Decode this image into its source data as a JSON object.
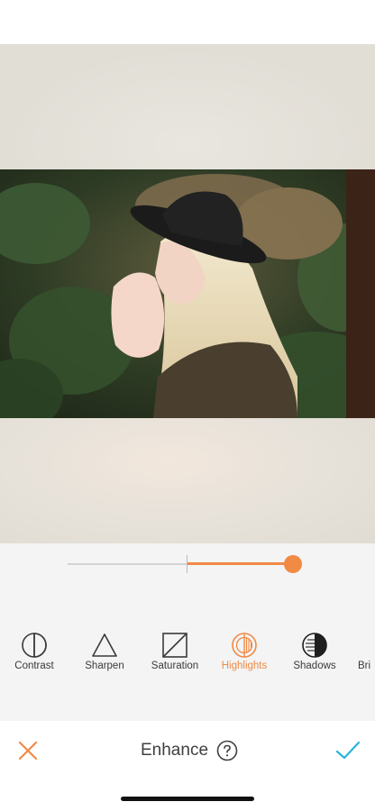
{
  "editor": {
    "title": "Enhance",
    "accent_color": "#f08a45",
    "confirm_color": "#2bb4d9"
  },
  "slider": {
    "value": 0.9,
    "min": -1,
    "max": 1
  },
  "tools": [
    {
      "label": "Contrast",
      "icon": "contrast-icon",
      "active": false
    },
    {
      "label": "Sharpen",
      "icon": "triangle-icon",
      "active": false
    },
    {
      "label": "Saturation",
      "icon": "saturation-icon",
      "active": false
    },
    {
      "label": "Highlights",
      "icon": "highlights-icon",
      "active": true
    },
    {
      "label": "Shadows",
      "icon": "shadows-icon",
      "active": false
    },
    {
      "label": "Bri",
      "icon": "brightness-icon",
      "active": false
    }
  ],
  "actions": {
    "cancel_icon": "close-icon",
    "confirm_icon": "checkmark-icon",
    "help_icon": "question-circle-icon"
  }
}
